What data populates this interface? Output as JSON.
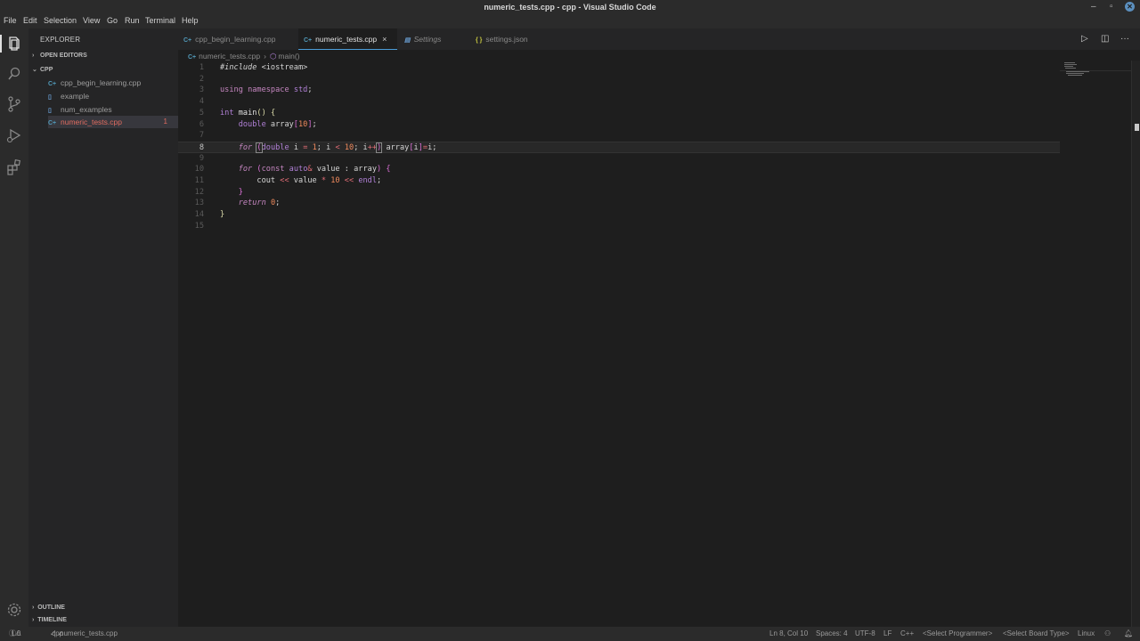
{
  "window": {
    "title": "numeric_tests.cpp - cpp - Visual Studio Code"
  },
  "menu": [
    "File",
    "Edit",
    "Selection",
    "View",
    "Go",
    "Run",
    "Terminal",
    "Help"
  ],
  "sidebar": {
    "title": "EXPLORER",
    "open_editors": "OPEN EDITORS",
    "folder": "CPP",
    "files": [
      {
        "name": "cpp_begin_learning.cpp",
        "icon": "C+"
      },
      {
        "name": "example",
        "icon": "doc"
      },
      {
        "name": "num_examples",
        "icon": "doc"
      },
      {
        "name": "numeric_tests.cpp",
        "icon": "C+",
        "badge": "1"
      }
    ],
    "outline": "OUTLINE",
    "timeline": "TIMELINE"
  },
  "tabs": [
    {
      "label": "cpp_begin_learning.cpp",
      "icon": "C+"
    },
    {
      "label": "numeric_tests.cpp",
      "icon": "C+",
      "close": "×"
    },
    {
      "label": "Settings",
      "icon": "gear-icon"
    },
    {
      "label": "settings.json",
      "icon": "{ }"
    }
  ],
  "tab_actions": {
    "run": "▷",
    "split": "◫",
    "more": "···"
  },
  "breadcrumb": {
    "file": "numeric_tests.cpp",
    "separator": "›",
    "symbol": "main()"
  },
  "editor": {
    "current_line": 8,
    "line_numbers": [
      "1",
      "2",
      "3",
      "4",
      "5",
      "6",
      "7",
      "8",
      "9",
      "10",
      "11",
      "12",
      "13",
      "14",
      "15"
    ]
  },
  "status": {
    "errors": "1",
    "warnings": "0",
    "branch": "cpp",
    "file": "numeric_tests.cpp",
    "position": "Ln 8, Col 10",
    "spaces": "Spaces: 4",
    "encoding": "UTF-8",
    "eol": "LF",
    "language": "C++",
    "programmer": "<Select Programmer>",
    "board": "<Select Board Type>",
    "os": "Linux"
  },
  "colors": {
    "accent": "#4c9dd8",
    "error": "#e06c60",
    "keyword": "#c586c0",
    "number": "#f08a5d"
  }
}
